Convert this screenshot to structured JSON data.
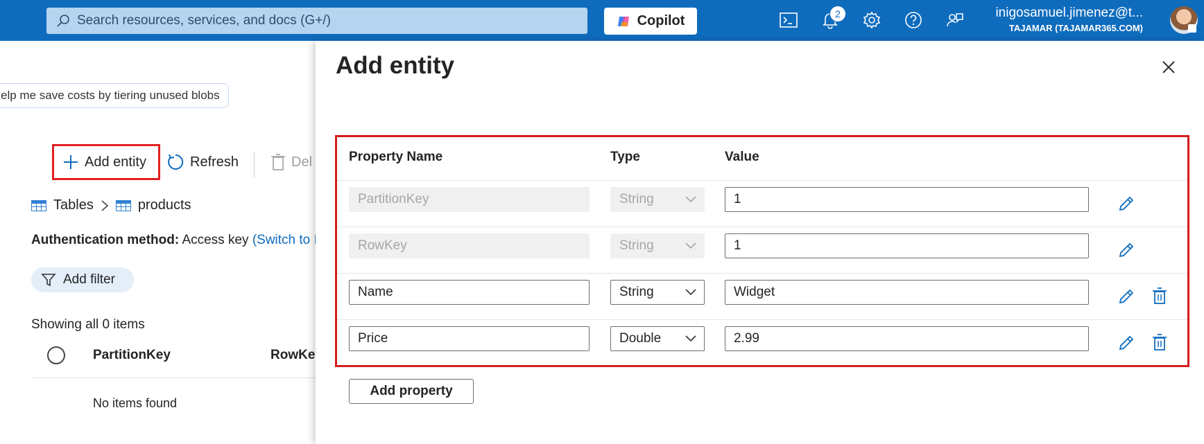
{
  "topbar": {
    "search_placeholder": "Search resources, services, and docs (G+/)",
    "copilot_label": "Copilot",
    "notification_count": "2",
    "user_email": "inigosamuel.jimenez@t...",
    "user_tenant": "TAJAMAR (TAJAMAR365.COM)",
    "brand_color": "#0f6cbd"
  },
  "background": {
    "suggestion_chip": "elp me save costs by tiering unused blobs",
    "toolbar": {
      "add_entity": "Add entity",
      "refresh": "Refresh",
      "delete": "Del"
    },
    "breadcrumb": {
      "root": "Tables",
      "current": "products"
    },
    "auth": {
      "label": "Authentication method:",
      "value": "Access key",
      "link": "(Switch to I"
    },
    "filter_label": "Add filter",
    "showing": "Showing all 0 items",
    "columns": {
      "partition_key": "PartitionKey",
      "row_key": "RowKey"
    },
    "empty_text": "No items found"
  },
  "panel": {
    "title": "Add entity",
    "headers": {
      "property_name": "Property Name",
      "type": "Type",
      "value": "Value"
    },
    "rows": [
      {
        "name": "PartitionKey",
        "type": "String",
        "value": "1",
        "locked": true
      },
      {
        "name": "RowKey",
        "type": "String",
        "value": "1",
        "locked": true
      },
      {
        "name": "Name",
        "type": "String",
        "value": "Widget",
        "locked": false
      },
      {
        "name": "Price",
        "type": "Double",
        "value": "2.99",
        "locked": false
      }
    ],
    "add_property": "Add property",
    "highlight_color": "#d41b1b"
  }
}
